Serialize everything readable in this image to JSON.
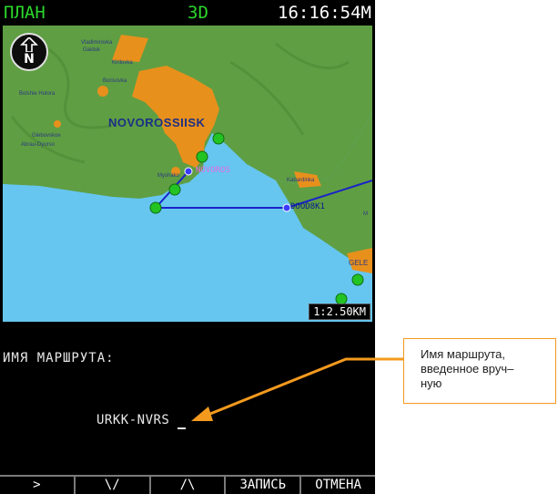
{
  "topbar": {
    "mode_left": "ПЛАН",
    "mode_center": "3D",
    "clock": "16:16:54M"
  },
  "map": {
    "compass_letter": "N",
    "scale": "1:2.50KM",
    "big_city": "NOVOROSSIISK",
    "towns": {
      "vladimirovka": "Vladimirovka",
      "gaiduk": "Gaiduk",
      "kirilovka": "Kirilovka",
      "borisovka": "Borisovka",
      "bolshie_hutora": "Bolshie Hutora",
      "glebovskoe": "Glebovskoe",
      "abrau_dyurso": "Abrau-Dyurso",
      "myshako": "Myshako",
      "kabardinka": "Kabardinka",
      "gele": "GELE",
      "m": "M"
    },
    "waypoints": {
      "novoros": "NOVOROS",
      "dood": "DOOD8K1"
    }
  },
  "panel": {
    "route_name_label": "ИМЯ МАРШРУТА:",
    "route_name_value": "URKK-NVRS"
  },
  "softkeys": [
    ">",
    "\\/",
    "/\\",
    "ЗАПИСЬ",
    "ОТМЕНА"
  ],
  "callout": {
    "text_line1": "Имя маршрута,",
    "text_line2": "введенное вруч–",
    "text_line3": "ную"
  },
  "colors": {
    "green": "#2cd62c",
    "sea": "#66c6f0",
    "land": "#5f9e43",
    "urban": "#e8901c",
    "route": "#1a22c8",
    "callout": "#f39a1e"
  }
}
